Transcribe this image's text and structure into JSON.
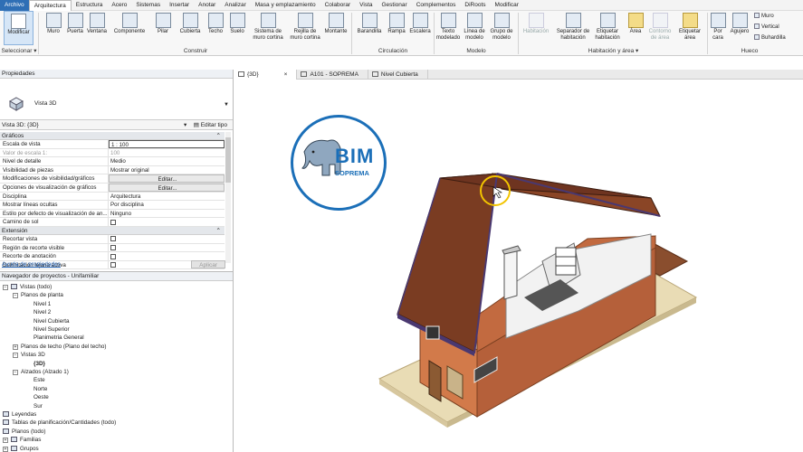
{
  "menu": {
    "tabs": [
      "Archivo",
      "Arquitectura",
      "Estructura",
      "Acero",
      "Sistemas",
      "Insertar",
      "Anotar",
      "Analizar",
      "Masa y emplazamiento",
      "Colaborar",
      "Vista",
      "Gestionar",
      "Complementos",
      "DiRoots",
      "Modificar"
    ],
    "active_index": 1
  },
  "ribbon": {
    "tools": {
      "modificar": "Modificar",
      "muro": "Muro",
      "puerta": "Puerta",
      "ventana": "Ventana",
      "componente": "Componente",
      "pilar": "Pilar",
      "cubierta": "Cubierta",
      "techo": "Techo",
      "suelo": "Suelo",
      "sistema_muro_cortina": "Sistema de muro cortina",
      "rejilla_muro_cortina": "Rejilla de muro cortina",
      "montante": "Montante",
      "barandilla": "Barandilla",
      "rampa": "Rampa",
      "escalera": "Escalera",
      "texto_modelado": "Texto modelado",
      "linea_modelo": "Línea de modelo",
      "grupo_modelo": "Grupo de modelo",
      "habitacion": "Habitación",
      "separador_habitacion": "Separador de habitación",
      "etiquetar_habitacion": "Etiquetar habitación",
      "area": "Área",
      "contorno_area": "Contorno de área",
      "etiquetar_area": "Etiquetar área",
      "por_cara": "Por cara",
      "agujero": "Agujero",
      "muro_small": "Muro",
      "vertical_small": "Vertical",
      "buhardilla_small": "Buhardilla"
    },
    "panels": {
      "seleccionar": "Seleccionar ▾",
      "construir": "Construir",
      "circulacion": "Circulación",
      "modelo": "Modelo",
      "habitacion_area": "Habitación y área ▾",
      "hueco": "Hueco"
    }
  },
  "properties": {
    "title": "Propiedades",
    "type_name": "Vista 3D",
    "instance_label": "Vista 3D: {3D}",
    "edit_type": "Editar tipo",
    "groups": {
      "graficos": "Gráficos",
      "extension": "Extensión"
    },
    "rows_graficos": [
      {
        "k": "Escala de vista",
        "v": "1 : 100"
      },
      {
        "k": "Valor de escala    1:",
        "v": "100"
      },
      {
        "k": "Nivel de detalle",
        "v": "Medio"
      },
      {
        "k": "Visibilidad de piezas",
        "v": "Mostrar original"
      },
      {
        "k": "Modificaciones de visibilidad/gráficos",
        "v": "Editar..."
      },
      {
        "k": "Opciones de visualización de gráficos",
        "v": "Editar..."
      },
      {
        "k": "Disciplina",
        "v": "Arquitectura"
      },
      {
        "k": "Mostrar líneas ocultas",
        "v": "Por disciplina"
      },
      {
        "k": "Estilo por defecto de visualización de an...",
        "v": "Ninguno"
      },
      {
        "k": "Camino de sol",
        "v": ""
      }
    ],
    "rows_extension": [
      {
        "k": "Recortar vista",
        "v": ""
      },
      {
        "k": "Región de recorte visible",
        "v": ""
      },
      {
        "k": "Recorte de anotación",
        "v": ""
      },
      {
        "k": "Delimitación lejana activa",
        "v": ""
      }
    ],
    "help_link": "Ayuda de propiedades",
    "apply": "Aplicar"
  },
  "browser": {
    "title": "Navegador de proyectos - Unifamiliar",
    "nodes": [
      {
        "t": "Vistas (todo)",
        "lvl": 0,
        "tog": "−",
        "icon": true
      },
      {
        "t": "Planos de planta",
        "lvl": 1,
        "tog": "−"
      },
      {
        "t": "Nivel 1",
        "lvl": 2
      },
      {
        "t": "Nivel 2",
        "lvl": 2
      },
      {
        "t": "Nivel Cubierta",
        "lvl": 2
      },
      {
        "t": "Nivel Superior",
        "lvl": 2
      },
      {
        "t": "Planimetria General",
        "lvl": 2
      },
      {
        "t": "Planos de techo (Plano del techo)",
        "lvl": 1,
        "tog": "+"
      },
      {
        "t": "Vistas 3D",
        "lvl": 1,
        "tog": "−"
      },
      {
        "t": "{3D}",
        "lvl": 2,
        "bold": true
      },
      {
        "t": "Alzados (Alzado 1)",
        "lvl": 1,
        "tog": "−"
      },
      {
        "t": "Este",
        "lvl": 2
      },
      {
        "t": "Norte",
        "lvl": 2
      },
      {
        "t": "Oeste",
        "lvl": 2
      },
      {
        "t": "Sur",
        "lvl": 2
      },
      {
        "t": "Leyendas",
        "lvl": 0,
        "icon": true
      },
      {
        "t": "Tablas de planificación/Cantidades (todo)",
        "lvl": 0,
        "icon": true
      },
      {
        "t": "Planos (todo)",
        "lvl": 0,
        "icon": true
      },
      {
        "t": "Familias",
        "lvl": 0,
        "tog": "+",
        "icon": true
      },
      {
        "t": "Grupos",
        "lvl": 0,
        "tog": "+",
        "icon": true
      }
    ]
  },
  "view_tabs": [
    {
      "label": "{3D}",
      "active": true,
      "close": "×"
    },
    {
      "label": "A101 - SOPREMA",
      "active": false
    },
    {
      "label": "Nivel Cubierta",
      "active": false
    }
  ],
  "logo": {
    "title": "BIM",
    "subtitle": "SOPREMA"
  },
  "colors": {
    "file_tab": "#2f6fb5",
    "roof": "#7a3c22",
    "wall": "#c9754a",
    "logo_blue": "#1b6fb8",
    "cursor_highlight": "#f2c400"
  }
}
